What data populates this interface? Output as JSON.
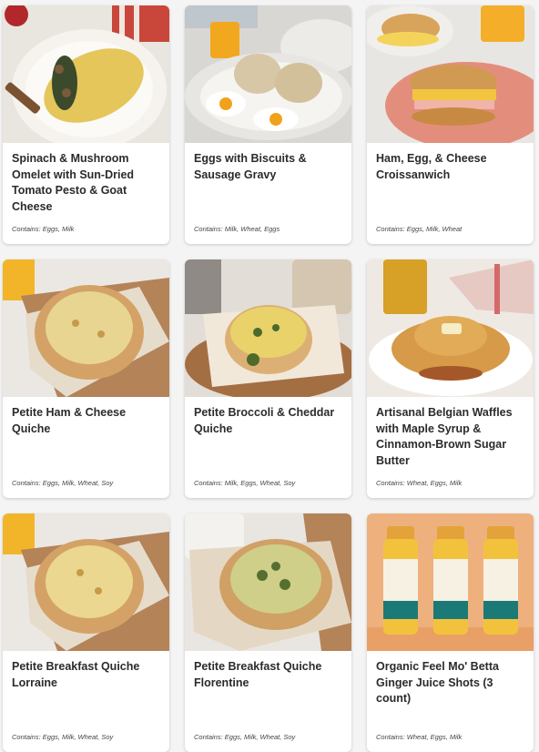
{
  "products": [
    {
      "name": "Spinach & Mushroom Omelet with Sun-Dried Tomato Pesto & Goat Cheese",
      "contains": "Contains: Eggs, Milk",
      "image": "omelet-plate"
    },
    {
      "name": "Eggs with Biscuits & Sausage Gravy",
      "contains": "Contains: Milk, Wheat, Eggs",
      "image": "biscuits-gravy-plate"
    },
    {
      "name": "Ham, Egg, & Cheese Croissanwich",
      "contains": "Contains: Eggs, Milk, Wheat",
      "image": "croissant-sandwich"
    },
    {
      "name": "Petite Ham & Cheese Quiche",
      "contains": "Contains: Eggs, Milk, Wheat, Soy",
      "image": "quiche-board"
    },
    {
      "name": "Petite Broccoli & Cheddar Quiche",
      "contains": "Contains: Milk, Eggs, Wheat, Soy",
      "image": "broccoli-quiche"
    },
    {
      "name": "Artisanal Belgian Waffles with Maple Syrup & Cinnamon-Brown Sugar Butter",
      "contains": "Contains: Wheat, Eggs, Milk",
      "image": "waffles-plate"
    },
    {
      "name": "Petite Breakfast Quiche Lorraine",
      "contains": "Contains: Eggs, Milk, Wheat, Soy",
      "image": "quiche-board"
    },
    {
      "name": "Petite Breakfast Quiche Florentine",
      "contains": "Contains: Eggs, Milk, Wheat, Soy",
      "image": "quiche-florentine"
    },
    {
      "name": "Organic Feel Mo' Betta Ginger Juice Shots (3 count)",
      "contains": "Contains: Wheat, Eggs, Milk",
      "image": "juice-bottles"
    }
  ],
  "colors": {
    "card_bg": "#ffffff",
    "page_bg": "#f4f4f4",
    "text": "#2b2b2b"
  }
}
